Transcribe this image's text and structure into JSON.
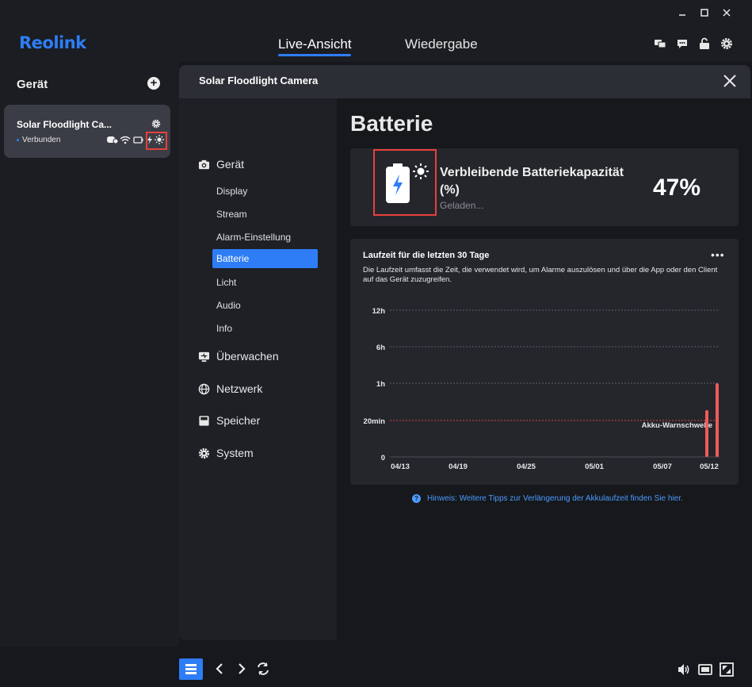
{
  "app": {
    "logo": "Reolink",
    "tabs": [
      {
        "label": "Live-Ansicht",
        "active": true
      },
      {
        "label": "Wiedergabe",
        "active": false
      }
    ],
    "top_icons": [
      "translate-icon",
      "chat-icon",
      "unlock-icon",
      "settings-icon"
    ],
    "window_controls": [
      "minimize-icon",
      "maximize-icon",
      "close-icon"
    ]
  },
  "sidebar": {
    "title": "Gerät",
    "device": {
      "name": "Solar Floodlight Ca...",
      "status": "Verbunden",
      "icons": [
        "cloud-icon",
        "wifi-icon",
        "battery-icon",
        "solar-charging-icon"
      ]
    }
  },
  "dialog": {
    "title": "Solar Floodlight Camera",
    "nav": {
      "groups": [
        {
          "label": "Gerät",
          "icon": "camera-icon",
          "items": [
            "Display",
            "Stream",
            "Alarm-Einstellung",
            "Batterie",
            "Licht",
            "Audio",
            "Info"
          ]
        },
        {
          "label": "Überwachen",
          "icon": "monitor-icon"
        },
        {
          "label": "Netzwerk",
          "icon": "globe-icon"
        },
        {
          "label": "Speicher",
          "icon": "storage-icon"
        },
        {
          "label": "System",
          "icon": "gear-icon"
        }
      ],
      "active_item": "Batterie"
    },
    "page_title": "Batterie",
    "battery": {
      "label": "Verbleibende Batteriekapazität (%)",
      "sub": "Geladen...",
      "percent": "47%",
      "level_fraction": 0.47
    },
    "chart_card": {
      "title": "Laufzeit für die letzten 30 Tage",
      "description": "Die Laufzeit umfasst die Zeit, die verwendet wird, um Alarme auszulösen und über die App oder den Client auf das Gerät zuzugreifen.",
      "threshold_label": "Akku-Warnschwelle"
    },
    "hint": "Hinweis: Weitere Tipps zur Verlängerung der Akkulaufzeit finden Sie hier."
  },
  "chart_data": {
    "type": "bar",
    "title": "Laufzeit für die letzten 30 Tage",
    "xlabel": "",
    "ylabel": "",
    "y_ticks": [
      "0",
      "20min",
      "1h",
      "6h",
      "12h"
    ],
    "x_ticks": [
      "04/13",
      "04/19",
      "04/25",
      "05/01",
      "05/07",
      "05/12"
    ],
    "threshold": {
      "label": "Akku-Warnschwelle",
      "value": "20min",
      "color": "#e6413b"
    },
    "bars": [
      {
        "date": "05/12",
        "runtime": "≈ 25min",
        "color": "#f05a5a"
      },
      {
        "date": "05/13",
        "runtime": "≈ 1h",
        "color": "#f05a5a"
      }
    ],
    "grid": true,
    "legend": "none"
  },
  "colors": {
    "accent": "#2e7df6",
    "highlight": "#e6413b",
    "bar": "#f05a5a"
  }
}
